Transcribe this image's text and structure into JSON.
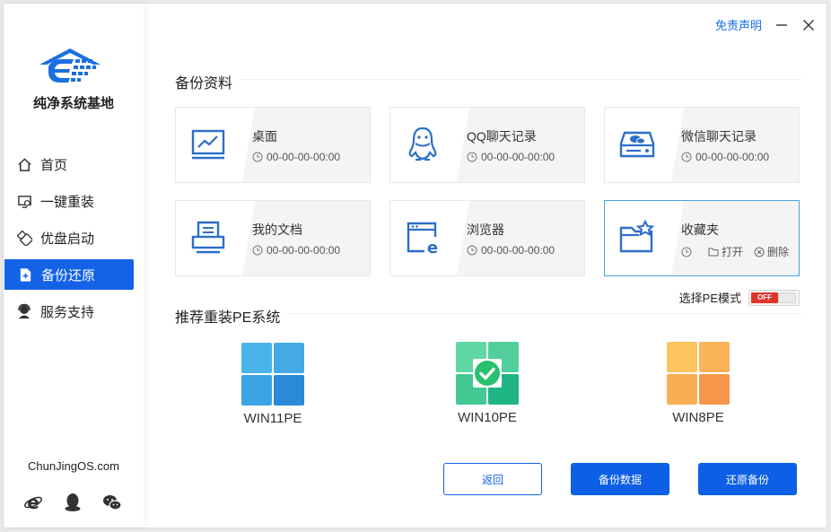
{
  "brand": {
    "name": "纯净系统基地",
    "site": "ChunJingOS.com"
  },
  "titlebar": {
    "disclaimer": "免责声明"
  },
  "nav": [
    {
      "label": "首页",
      "icon": "home-icon"
    },
    {
      "label": "一键重装",
      "icon": "reinstall-icon"
    },
    {
      "label": "优盘启动",
      "icon": "usb-icon"
    },
    {
      "label": "备份还原",
      "icon": "backup-icon",
      "active": true
    },
    {
      "label": "服务支持",
      "icon": "support-icon"
    }
  ],
  "backup": {
    "title": "备份资料",
    "items": [
      {
        "name": "桌面",
        "time": "00-00-00-00:00",
        "icon": "monitor-icon"
      },
      {
        "name": "QQ聊天记录",
        "time": "00-00-00-00:00",
        "icon": "qq-icon"
      },
      {
        "name": "微信聊天记录",
        "time": "00-00-00-00:00",
        "icon": "disk-icon"
      },
      {
        "name": "我的文档",
        "time": "00-00-00-00:00",
        "icon": "printer-icon"
      },
      {
        "name": "浏览器",
        "time": "00-00-00-00:00",
        "icon": "browser-icon"
      },
      {
        "name": "收藏夹",
        "icon": "folder-star-icon",
        "open_label": "打开",
        "delete_label": "删除"
      }
    ]
  },
  "pe_mode": {
    "label": "选择PE模式",
    "toggle_text": "OFF"
  },
  "pe": {
    "title": "推荐重装PE系统",
    "items": [
      {
        "label": "WIN11PE",
        "colors": [
          "#4ab3ea",
          "#2a8ad8"
        ]
      },
      {
        "label": "WIN10PE",
        "colors": [
          "#58d6a0",
          "#21b585"
        ],
        "selected": true
      },
      {
        "label": "WIN8PE",
        "colors": [
          "#fbbf55",
          "#f7964a"
        ]
      }
    ]
  },
  "buttons": {
    "back": "返回",
    "backup_data": "备份数据",
    "restore_backup": "还原备份"
  },
  "colors": {
    "accent": "#1463e6",
    "icon_blue": "#2c6fc9",
    "toggle_off": "#e0342b"
  }
}
